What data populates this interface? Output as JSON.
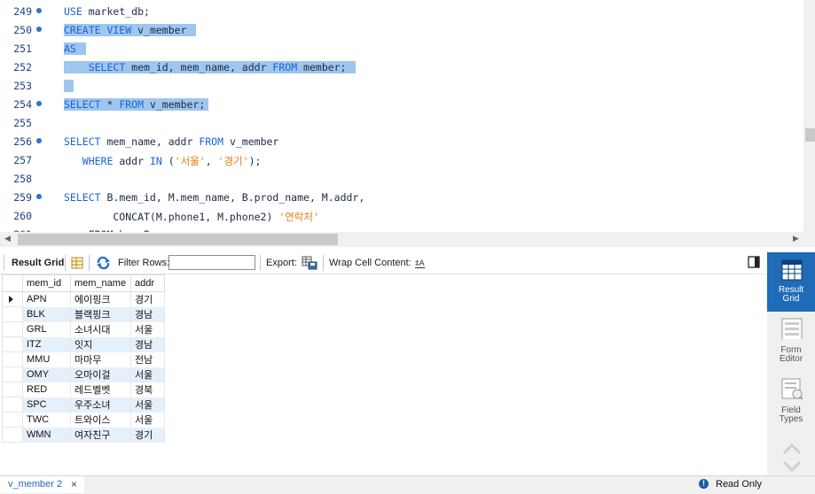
{
  "editor": {
    "lines": [
      {
        "num": "249",
        "dot": true,
        "html": "<span class='kw'>USE</span> market_db;"
      },
      {
        "num": "250",
        "dot": true,
        "html": "<span class='sel'><span class='kw'>CREATE VIEW</span> v_member </span>"
      },
      {
        "num": "251",
        "dot": false,
        "html": "<span class='sel'><span class='kw'>AS</span> </span>"
      },
      {
        "num": "252",
        "dot": false,
        "html": "<span class='sel'>    <span class='kw'>SELECT</span> mem_id, mem_name, addr <span class='kw'>FROM</span> member; </span>"
      },
      {
        "num": "253",
        "dot": false,
        "html": "<span class='sel'> </span>"
      },
      {
        "num": "254",
        "dot": true,
        "html": "<span class='sel'><span class='kw'>SELECT</span> * <span class='kw'>FROM</span> v_member;</span>"
      },
      {
        "num": "255",
        "dot": false,
        "html": ""
      },
      {
        "num": "256",
        "dot": true,
        "html": "<span class='kw'>SELECT</span> mem_name, addr <span class='kw'>FROM</span> v_member"
      },
      {
        "num": "257",
        "dot": false,
        "html": "   <span class='kw'>WHERE</span> addr <span class='kw'>IN</span> (<span class='str'>'서울'</span>, <span class='str'>'경기'</span>);"
      },
      {
        "num": "258",
        "dot": false,
        "html": ""
      },
      {
        "num": "259",
        "dot": true,
        "html": "<span class='kw'>SELECT</span> B.mem_id, M.mem_name, B.prod_name, M.addr,"
      },
      {
        "num": "260",
        "dot": false,
        "html": "        CONCAT(M.phone1, M.phone2) <span class='str'>'연락처'</span>"
      },
      {
        "num": "261",
        "dot": false,
        "html": "    FROM buy B"
      }
    ]
  },
  "toolbar": {
    "result_grid_label": "Result Grid",
    "filter_rows_label": "Filter Rows:",
    "filter_value": "",
    "export_label": "Export:",
    "wrap_label": "Wrap Cell Content:"
  },
  "grid": {
    "columns": [
      "mem_id",
      "mem_name",
      "addr"
    ],
    "rows": [
      [
        "APN",
        "에이핑크",
        "경기"
      ],
      [
        "BLK",
        "블랙핑크",
        "경남"
      ],
      [
        "GRL",
        "소녀시대",
        "서울"
      ],
      [
        "ITZ",
        "잇지",
        "경남"
      ],
      [
        "MMU",
        "마마무",
        "전남"
      ],
      [
        "OMY",
        "오마이걸",
        "서울"
      ],
      [
        "RED",
        "레드벨벳",
        "경북"
      ],
      [
        "SPC",
        "우주소녀",
        "서울"
      ],
      [
        "TWC",
        "트와이스",
        "서울"
      ],
      [
        "WMN",
        "여자친구",
        "경기"
      ]
    ]
  },
  "panel": {
    "result_grid": [
      "Result",
      "Grid"
    ],
    "form_editor": [
      "Form",
      "Editor"
    ],
    "field_types": [
      "Field",
      "Types"
    ]
  },
  "bottom": {
    "tab_label": "v_member 2",
    "tab_close": "×",
    "read_only_label": "Read Only",
    "read_only_icon": "!"
  },
  "colors": {
    "keyword": "#1a64d6",
    "string": "#e07b0c",
    "selection": "#9fc6ee",
    "accent": "#1e6bb8",
    "row_alt": "#e6f0fb"
  }
}
